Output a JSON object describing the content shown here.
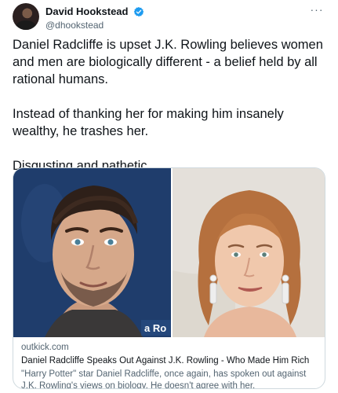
{
  "author": {
    "display_name": "David Hookstead",
    "handle": "@dhookstead",
    "verified": true
  },
  "menu": {
    "more_label": "···"
  },
  "tweet": {
    "paragraphs": [
      "Daniel Radcliffe is upset J.K. Rowling believes women and men are biologically different - a belief held by all rational humans.",
      "Instead of thanking her for making him insanely wealthy, he trashes her.",
      "Disgusting and pathetic."
    ]
  },
  "link_card": {
    "domain": "outkick.com",
    "title": "Daniel Radcliffe Speaks Out Against J.K. Rowling - Who Made Him Rich",
    "description": "\"Harry Potter\" star Daniel Radcliffe, once again, has spoken out against J.K. Rowling's views on biology. He doesn't agree with her.",
    "image_watermark": "a Ro"
  },
  "colors": {
    "verified_blue": "#1d9bf0",
    "secondary_text": "#536471",
    "card_border": "#cfd9de"
  }
}
